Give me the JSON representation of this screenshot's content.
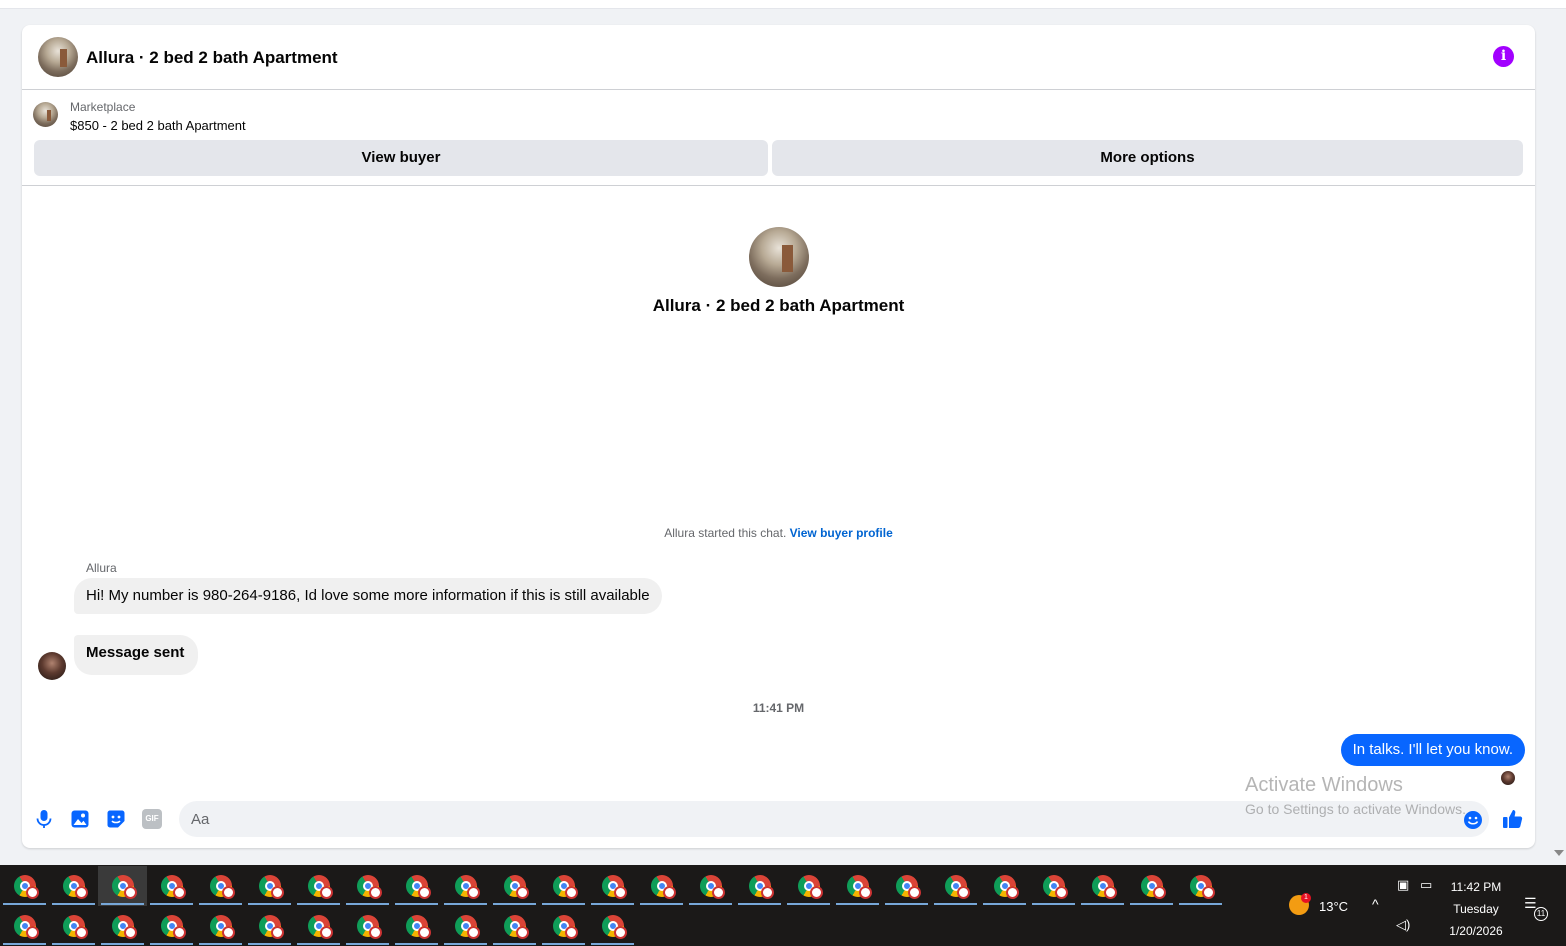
{
  "header": {
    "title": "Allura · 2 bed 2 bath Apartment",
    "info_icon": "info-icon"
  },
  "listing": {
    "category": "Marketplace",
    "price_title": "$850 - 2 bed 2 bath Apartment",
    "view_buyer_label": "View buyer",
    "more_options_label": "More options"
  },
  "conversation": {
    "title": "Allura · 2 bed 2 bath Apartment",
    "started_text": "Allura started this chat.",
    "buyer_profile_link": "View buyer profile",
    "messages": [
      {
        "sender": "Allura",
        "text": "Hi! My number is 980-264-9186, Id love some more information if this is still available"
      },
      {
        "text": "Message sent"
      }
    ],
    "timestamp": "11:41 PM",
    "outgoing": {
      "text": "In talks. I'll let you know."
    }
  },
  "composer": {
    "placeholder": "Aa",
    "icons": [
      "microphone-icon",
      "photo-icon",
      "sticker-icon",
      "gif-icon",
      "emoji-icon",
      "thumbs-up-icon"
    ],
    "gif_label": "GIF"
  },
  "watermark": {
    "line1": "Activate Windows",
    "line2": "Go to Settings to activate Windows."
  },
  "taskbar": {
    "row1_count": 25,
    "row2_count": 13,
    "weather_badge": "1",
    "temperature": "13°C",
    "time": "11:42 PM",
    "day": "Tuesday",
    "date": "1/20/2026",
    "notifications": "11"
  },
  "colors": {
    "accent_blue": "#0866ff",
    "info_purple": "#a200ff",
    "link_blue": "#0064d1"
  }
}
